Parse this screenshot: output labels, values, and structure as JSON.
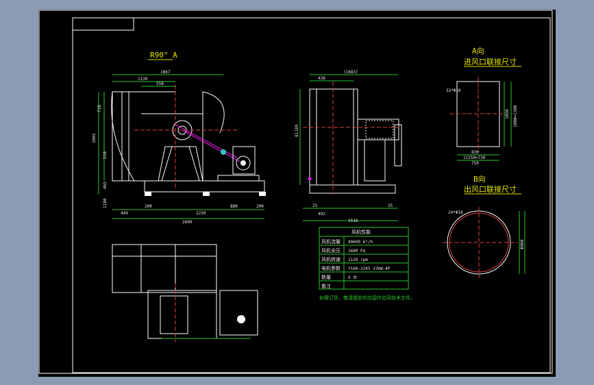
{
  "views": {
    "front_title": "R90° A",
    "a_view_title": "A向",
    "a_view_subtitle": "进风口联接尺寸",
    "b_view_title": "B向",
    "b_view_subtitle": "出风口联接尺寸"
  },
  "dims": {
    "front_top": "1867",
    "front_a": "1130",
    "front_b": "558",
    "front_left1": "710",
    "front_left2": "1665",
    "front_left3": "510",
    "front_left4": "465",
    "front_left5": "1180",
    "front_bottom1": "449",
    "front_bottom2": "200",
    "front_bottom3": "2220",
    "front_bottom4": "880",
    "front_bottom5": "200",
    "front_total": "2600",
    "side_top": "(1683)",
    "side_a": "438",
    "side_left": "81189",
    "side_b1": "25",
    "side_b2": "25",
    "side_b3": "492",
    "side_total": "1516",
    "a_left": "32*Φ10",
    "a_w1": "830",
    "a_w2": "11250=720",
    "a_w3": "750",
    "a_r1": "1050",
    "a_r2": "1080=1380",
    "b_left": "24*Φ18",
    "b_r": "Φ960"
  },
  "spec_table": {
    "title": "风机性能",
    "rows": [
      {
        "label": "风机流量",
        "value": "49609 m³/h"
      },
      {
        "label": "风机全压",
        "value": "1680 Pa"
      },
      {
        "label": "风机转速",
        "value": "1120 rpm"
      },
      {
        "label": "电机参数",
        "value": "Y160-2245 37KW-4P"
      },
      {
        "label": "数量",
        "value": "X 台"
      },
      {
        "label": "备注",
        "value": ""
      }
    ],
    "note": "如需订货，敬请提前供应国作合同技术文件。"
  }
}
